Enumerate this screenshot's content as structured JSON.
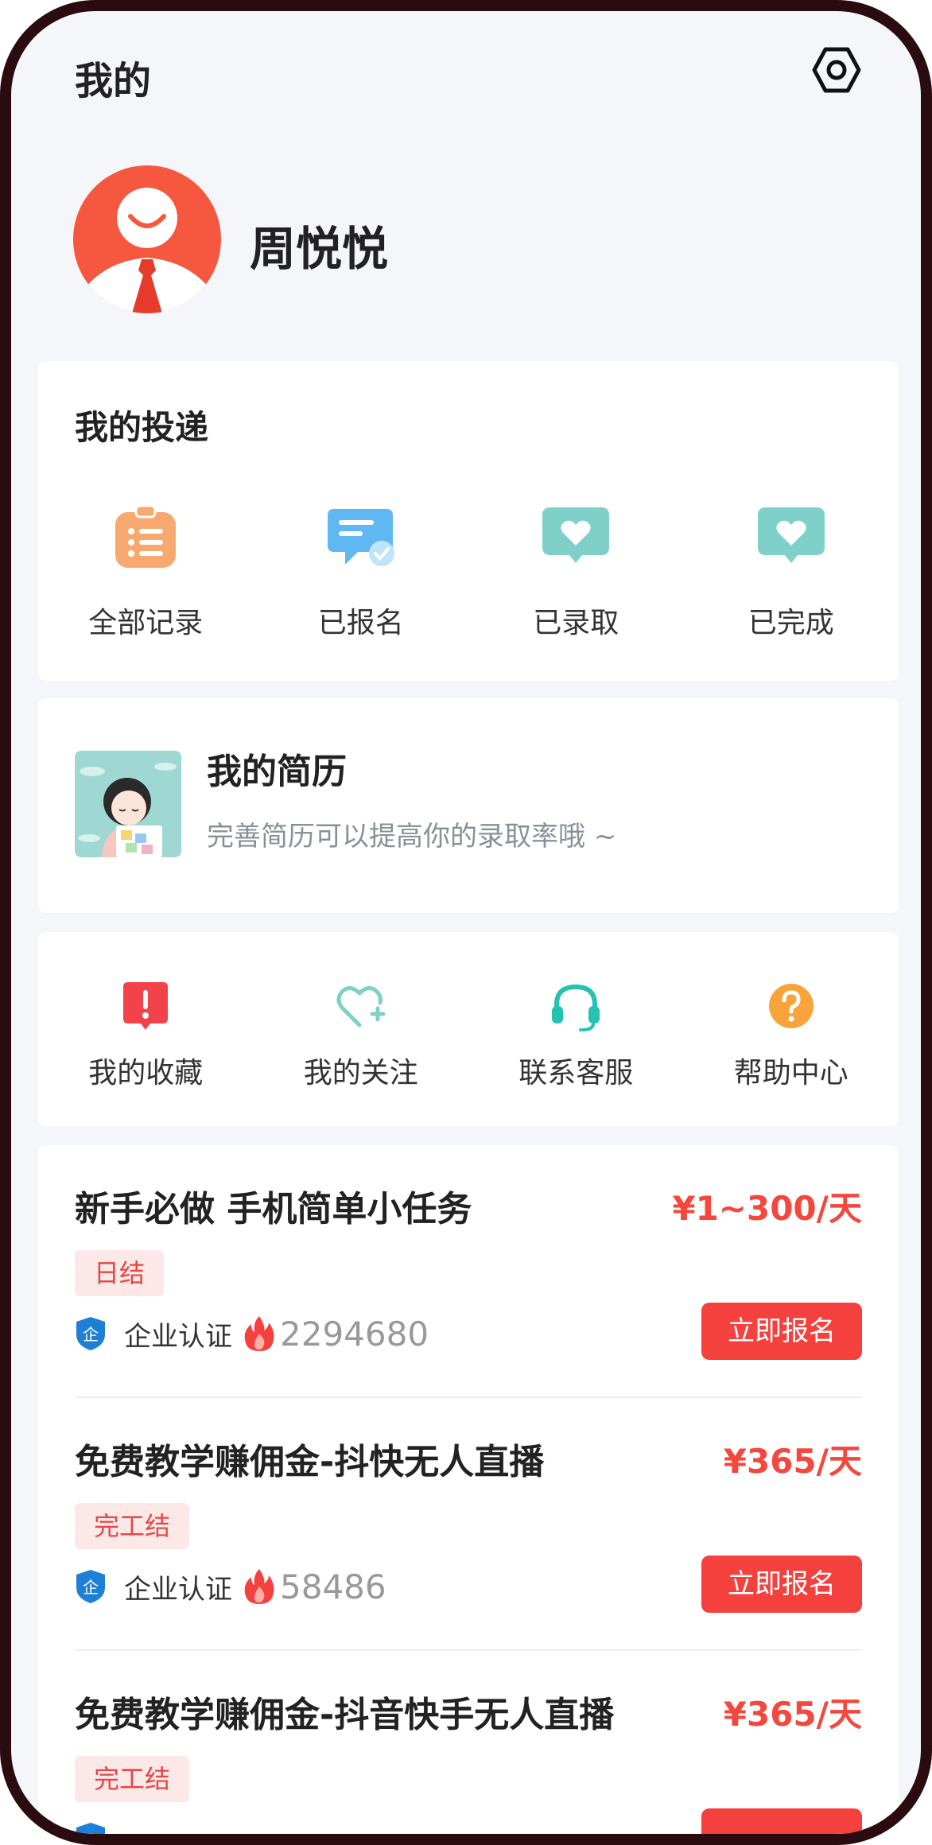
{
  "header": {
    "title": "我的",
    "settings_icon": "settings-hex-icon"
  },
  "profile": {
    "name": "周悦悦",
    "avatar_icon": "user-avatar-icon"
  },
  "delivery": {
    "title": "我的投递",
    "items": [
      {
        "label": "全部记录",
        "icon": "clipboard-list-icon",
        "color": "#f7a96f"
      },
      {
        "label": "已报名",
        "icon": "message-check-icon",
        "color": "#5fb8f2"
      },
      {
        "label": "已录取",
        "icon": "heart-bubble-icon",
        "color": "#7fd0c8"
      },
      {
        "label": "已完成",
        "icon": "heart-bubble-icon",
        "color": "#7fd0c8"
      }
    ]
  },
  "resume": {
    "title": "我的简历",
    "subtitle": "完善简历可以提高你的录取率哦 ~"
  },
  "shortcuts": {
    "items": [
      {
        "label": "我的收藏",
        "icon": "exclamation-icon",
        "color": "#f3434a"
      },
      {
        "label": "我的关注",
        "icon": "heart-plus-icon",
        "color": "#7fd0c8"
      },
      {
        "label": "联系客服",
        "icon": "headset-icon",
        "color": "#24c2b0"
      },
      {
        "label": "帮助中心",
        "icon": "question-icon",
        "color": "#f8a43a"
      }
    ]
  },
  "jobs": [
    {
      "title": "新手必做 手机简单小任务",
      "salary": "¥1~300/天",
      "tag": "日结",
      "verified": "企业认证",
      "heat": "2294680",
      "apply": "立即报名"
    },
    {
      "title": "免费教学赚佣金-抖快无人直播",
      "salary": "¥365/天",
      "tag": "完工结",
      "verified": "企业认证",
      "heat": "58486",
      "apply": "立即报名"
    },
    {
      "title": "免费教学赚佣金-抖音快手无人直播",
      "salary": "¥365/天",
      "tag": "完工结",
      "verified": "",
      "heat": "",
      "apply": ""
    }
  ],
  "colors": {
    "accent": "#f4413d",
    "background": "#f5f6fa",
    "bezel": "#2a0b10"
  }
}
